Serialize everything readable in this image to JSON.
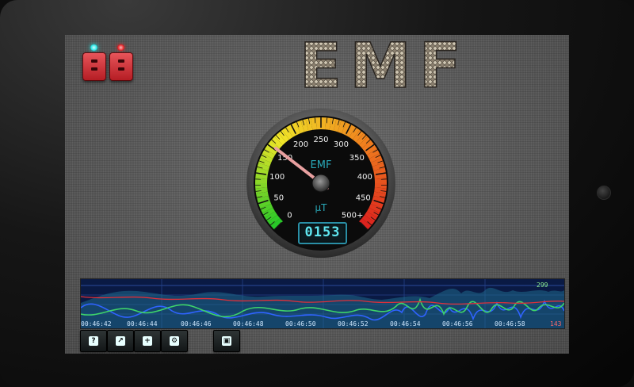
{
  "app": {
    "title": "EMF"
  },
  "colors": {
    "lcd_text": "#5fe6f0",
    "needle": "#e8a0a0",
    "graph_bg": "#0a1a44"
  },
  "gauge": {
    "label": "EMF",
    "unit": "µT",
    "scale_labels": [
      "0",
      "50",
      "100",
      "150",
      "200",
      "250",
      "300",
      "350",
      "400",
      "450",
      "500+"
    ],
    "needle_value": 153,
    "max_value": 500,
    "lcd_reading": "0153"
  },
  "graph": {
    "max_label": "299",
    "min_label": "143",
    "time_ticks": [
      "00:46:42",
      "00:46:44",
      "00:46:46",
      "00:46:48",
      "00:46:50",
      "00:46:52",
      "00:46:54",
      "00:46:56",
      "00:46:58"
    ]
  },
  "device_icons": [
    {
      "name": "device-1",
      "led": "cyan"
    },
    {
      "name": "device-2",
      "led": "red"
    }
  ],
  "toolbar": [
    {
      "icon": "help-icon",
      "glyph": "?"
    },
    {
      "icon": "chart-icon",
      "glyph": "↗"
    },
    {
      "icon": "add-icon",
      "glyph": "+"
    },
    {
      "icon": "settings-icon",
      "glyph": "⚙"
    },
    {
      "icon": "save-icon",
      "glyph": "▣"
    }
  ]
}
